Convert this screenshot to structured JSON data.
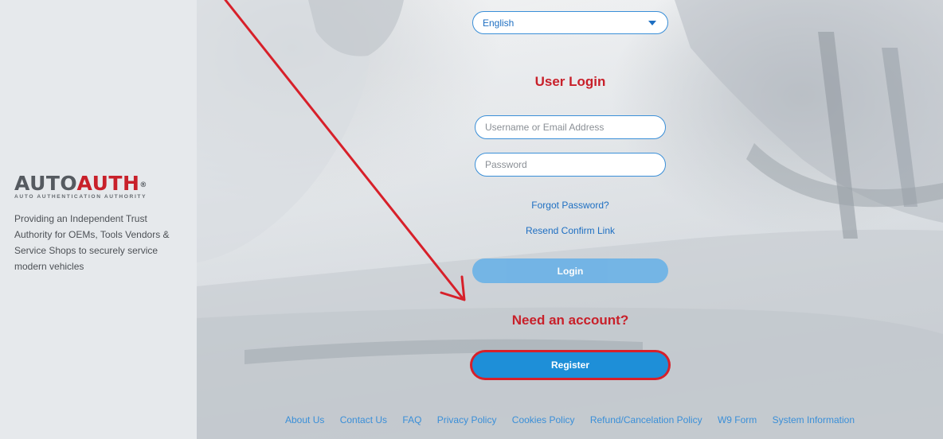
{
  "brand": {
    "logo_part1": "AUTO",
    "logo_part2": "AUTH",
    "logo_registered": "®",
    "logo_subtitle": "AUTO AUTHENTICATION AUTHORITY",
    "tagline": "Providing an Independent Trust Authority for OEMs, Tools Vendors & Service Shops to securely service modern vehicles"
  },
  "language": {
    "selected": "English"
  },
  "login": {
    "title": "User Login",
    "username_placeholder": "Username or Email Address",
    "password_placeholder": "Password",
    "forgot_password": "Forgot Password?",
    "resend_confirm": "Resend Confirm Link",
    "login_button": "Login"
  },
  "register": {
    "title": "Need an account?",
    "button": "Register"
  },
  "footer": {
    "links": [
      "About Us",
      "Contact Us",
      "FAQ",
      "Privacy Policy",
      "Cookies Policy",
      "Refund/Cancelation Policy",
      "W9 Form",
      "System Information"
    ]
  },
  "colors": {
    "accent_red": "#c8202a",
    "link_blue": "#1e6fc2",
    "button_blue": "#1e8fd8",
    "highlight_red": "#d7202a"
  },
  "icons": {
    "language_dropdown": "chevron-down-icon",
    "annotation": "arrow-annotation-icon"
  }
}
